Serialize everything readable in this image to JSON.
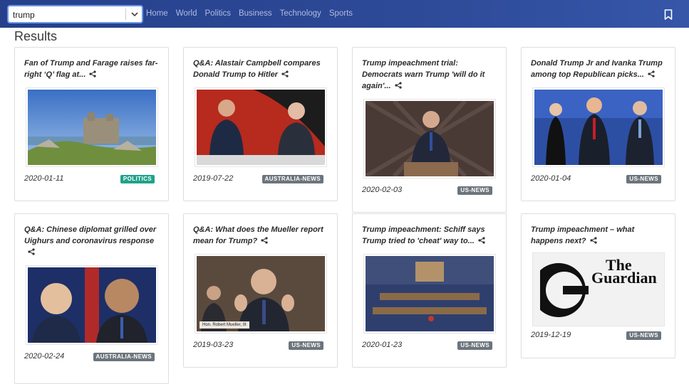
{
  "search": {
    "value": "trump"
  },
  "nav": {
    "links": [
      "Home",
      "World",
      "Politics",
      "Business",
      "Technology",
      "Sports"
    ]
  },
  "results_heading": "Results",
  "cards": [
    {
      "title": "Fan of Trump and Farage raises far-right ‘Q’ flag at...",
      "date": "2020-01-11",
      "badge": "POLITICS",
      "image": "castle-photo"
    },
    {
      "title": "Q&A: Alastair Campbell compares Donald Trump to Hitler",
      "date": "2019-07-22",
      "badge": "AUSTRALIA-NEWS",
      "image": "tv-panel-photo"
    },
    {
      "title": "Trump impeachment trial: Democrats warn Trump 'will do it again'...",
      "date": "2020-02-03",
      "badge": "US-NEWS",
      "image": "senate-podium-photo"
    },
    {
      "title": "Donald Trump Jr and Ivanka Trump among top Republican picks...",
      "date": "2020-01-04",
      "badge": "US-NEWS",
      "image": "family-photo"
    },
    {
      "title": "Q&A: Chinese diplomat grilled over Uighurs and coronavirus response",
      "date": "2020-02-24",
      "badge": "AUSTRALIA-NEWS",
      "image": "diplomat-photo"
    },
    {
      "title": "Q&A: What does the Mueller report mean for Trump?",
      "date": "2019-03-23",
      "badge": "US-NEWS",
      "image": "mueller-photo",
      "caption": "Hon. Robert Mueller, III"
    },
    {
      "title": "Trump impeachment: Schiff says Trump tried to 'cheat' way to...",
      "date": "2020-01-23",
      "badge": "US-NEWS",
      "image": "senate-chamber-photo"
    },
    {
      "title": "Trump impeachment – what happens next?",
      "date": "2019-12-19",
      "badge": "US-NEWS",
      "image": "guardian-logo",
      "logo_text": [
        "The",
        "Guardian"
      ]
    }
  ],
  "colors": {
    "navbar": "#2d4a98",
    "politics_badge": "#1fa28a",
    "news_badge": "#6c757d"
  }
}
